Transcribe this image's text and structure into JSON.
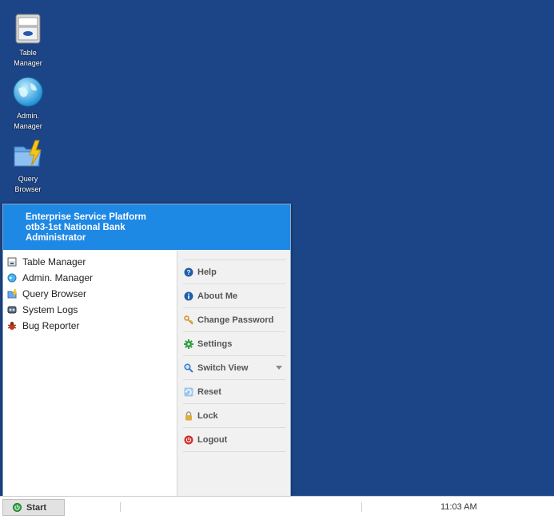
{
  "desktop": {
    "icons": [
      {
        "label_line1": "Table",
        "label_line2": "Manager",
        "icon": "table-manager-icon"
      },
      {
        "label_line1": "Admin.",
        "label_line2": "Manager",
        "icon": "globe-icon"
      },
      {
        "label_line1": "Query",
        "label_line2": "Browser",
        "icon": "folder-lightning-icon"
      }
    ]
  },
  "start_menu": {
    "header": {
      "line1": "Enterprise Service Platform",
      "line2": "otb3-1st National Bank",
      "line3": "Administrator"
    },
    "apps": [
      {
        "label": "Table Manager",
        "icon": "table-icon"
      },
      {
        "label": "Admin. Manager",
        "icon": "globe-icon"
      },
      {
        "label": "Query Browser",
        "icon": "folder-icon"
      },
      {
        "label": "System Logs",
        "icon": "logs-icon"
      },
      {
        "label": "Bug Reporter",
        "icon": "bug-icon"
      }
    ],
    "actions": [
      {
        "label": "Help",
        "icon": "help-icon",
        "color": "#1f5fa8"
      },
      {
        "label": "About Me",
        "icon": "info-icon",
        "color": "#1f5fa8"
      },
      {
        "label": "Change Password",
        "icon": "key-icon",
        "color": "#e0a030"
      },
      {
        "label": "Settings",
        "icon": "gear-icon",
        "color": "#2e9e3e"
      },
      {
        "label": "Switch View",
        "icon": "magnifier-icon",
        "color": "#3a7bc8"
      },
      {
        "label": "Reset",
        "icon": "refresh-icon",
        "color": "#4a8fd0"
      },
      {
        "label": "Lock",
        "icon": "lock-icon",
        "color": "#d9a83a"
      },
      {
        "label": "Logout",
        "icon": "power-icon",
        "color": "#d0302b"
      }
    ]
  },
  "taskbar": {
    "start_label": "Start",
    "clock": "11:03 AM"
  }
}
